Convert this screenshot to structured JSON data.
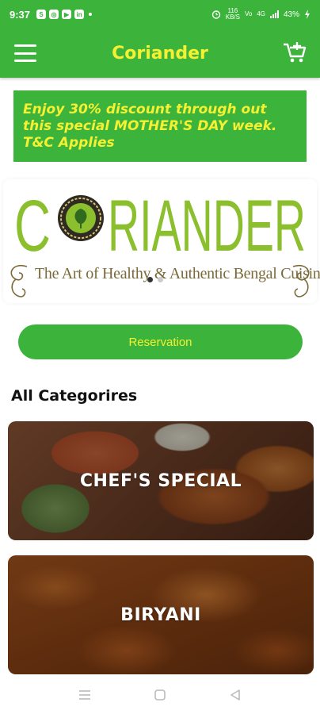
{
  "status_bar": {
    "time": "9:37",
    "apps": [
      "S",
      "◎",
      "▶",
      "in"
    ],
    "net_speed_top": "116",
    "net_speed_bottom": "KB/S",
    "net_1": "Vo",
    "net_2": "4G",
    "battery": "43%"
  },
  "app_bar": {
    "title": "Coriander",
    "menu_icon": "hamburger-menu-icon",
    "cart_icon": "add-to-cart-icon"
  },
  "promo": {
    "text": "Enjoy 30% discount through out this special MOTHER'S DAY week. T&C Applies"
  },
  "logo": {
    "brand": "CORIANDER",
    "tagline": "The Art of Healthy & Authentic Bengal Cuisine"
  },
  "reservation_button": {
    "label": "Reservation"
  },
  "categories_section": {
    "title": "All Categorires",
    "items": [
      {
        "label": "CHEF'S SPECIAL"
      },
      {
        "label": "BIRYANI"
      }
    ]
  },
  "colors": {
    "primary": "#3cb43c",
    "accent_yellow": "#f5f032",
    "logo_green": "#8cbf2e"
  }
}
